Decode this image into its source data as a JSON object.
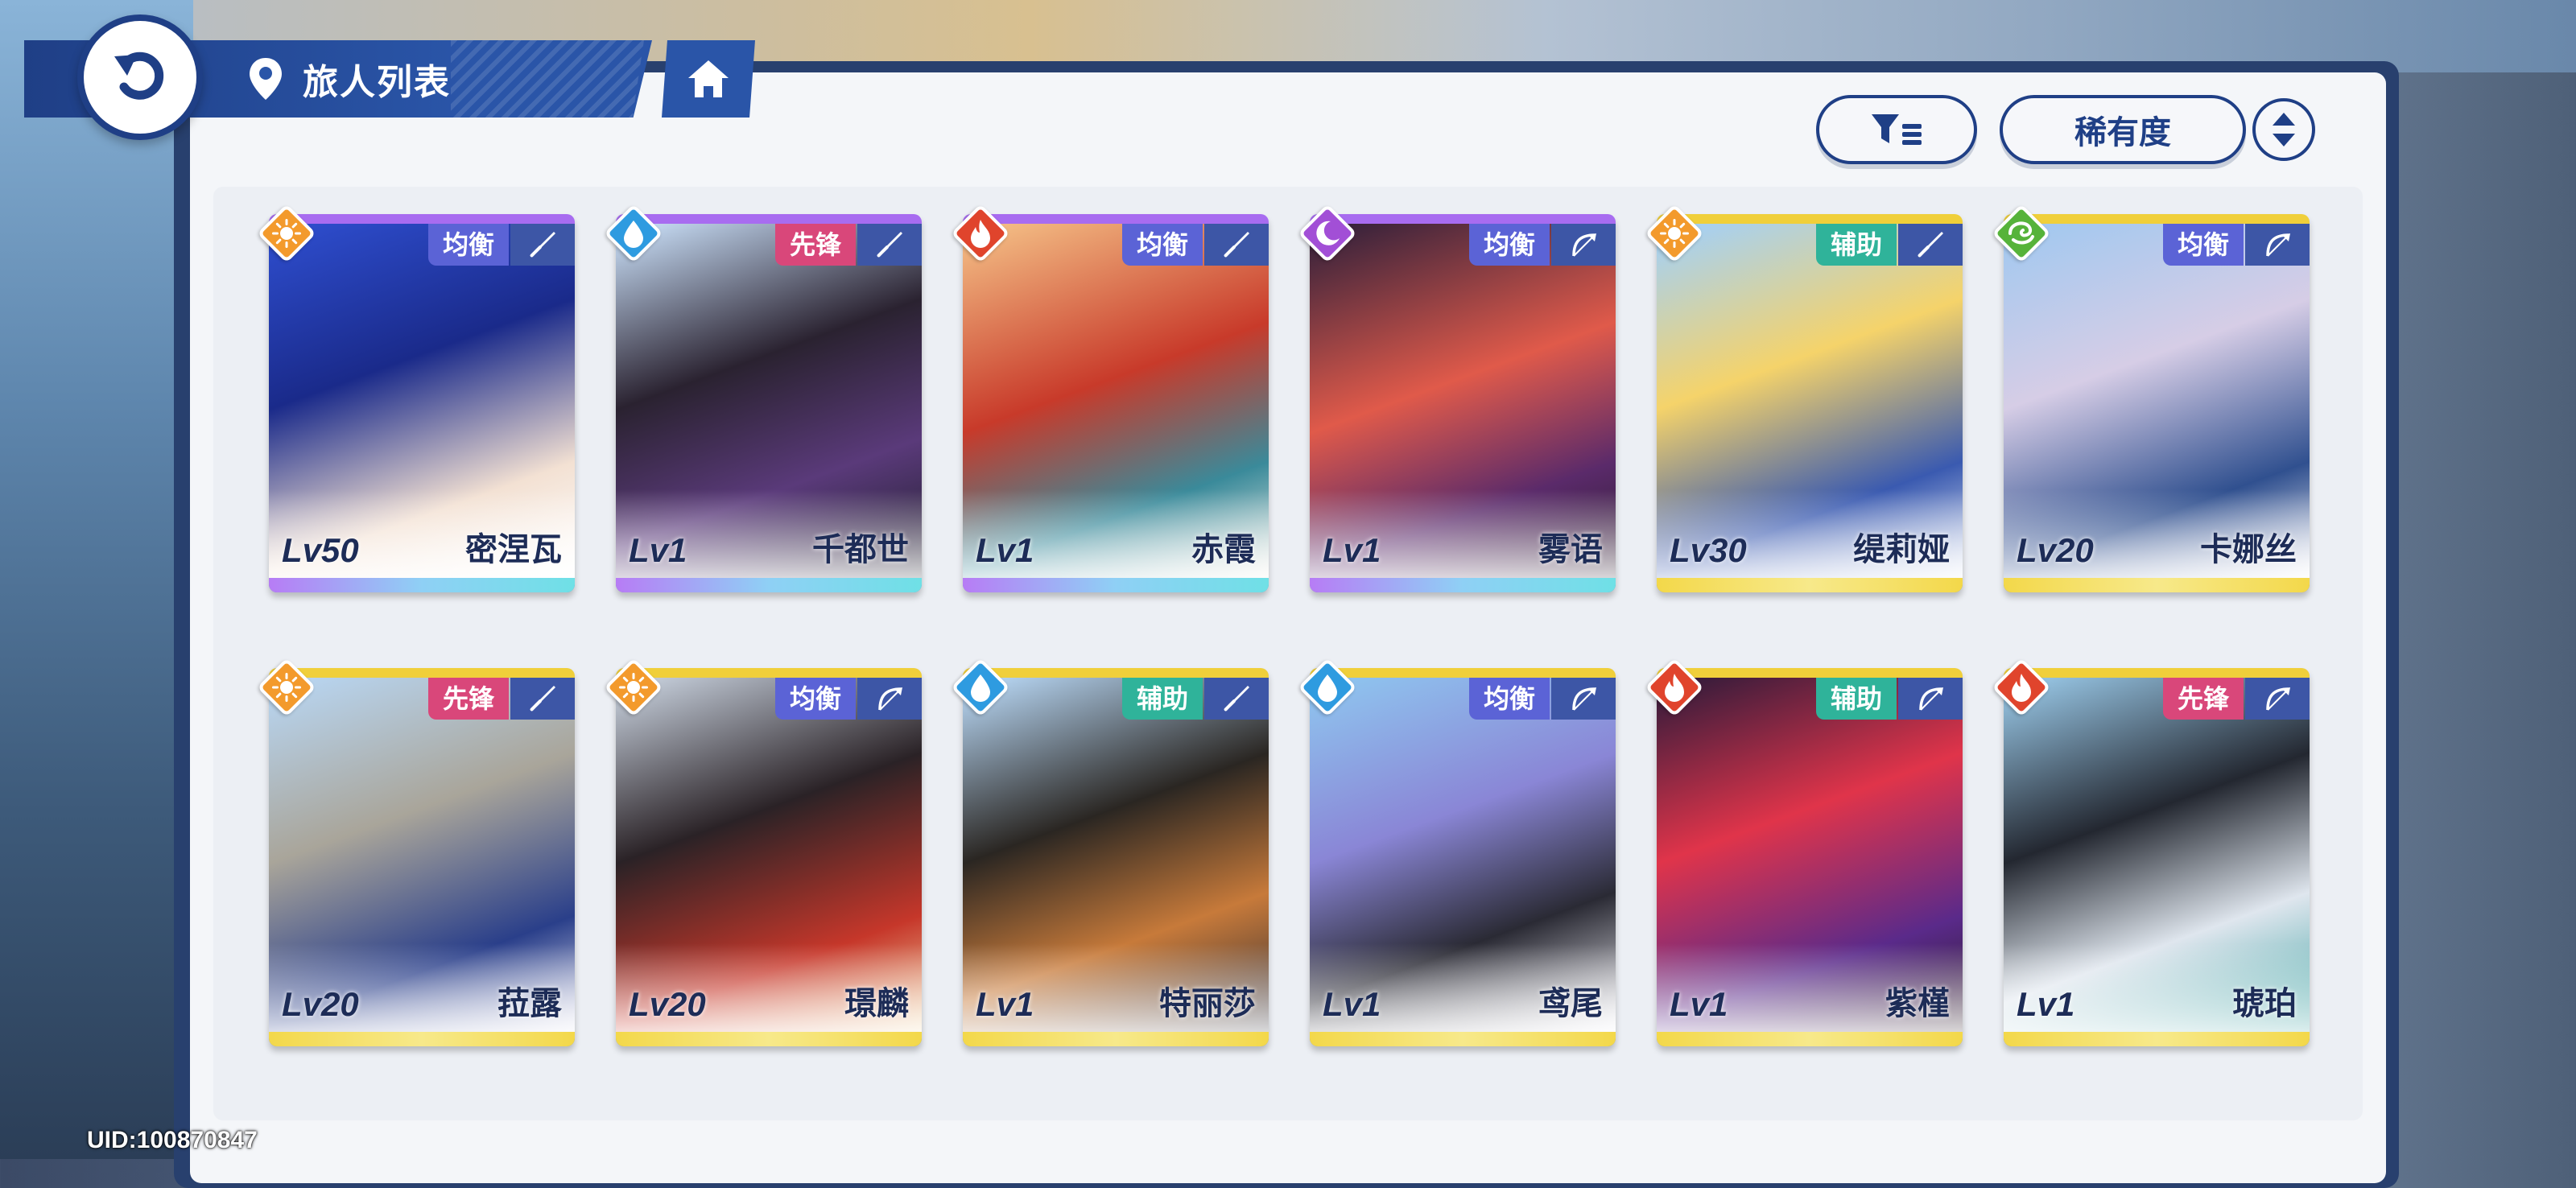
{
  "header": {
    "title": "旅人列表"
  },
  "toolbar": {
    "sort_label": "稀有度"
  },
  "user": {
    "uid": "UID:100870847"
  },
  "colors": {
    "navy": "#1f3f86",
    "role_balance": "#5b63d6",
    "role_vanguard": "#d9477a",
    "role_support": "#2fb39a",
    "rarity_purple": "#a86cf0",
    "rarity_gold": "#f0cf3a"
  },
  "characters": [
    {
      "name": "密涅瓦",
      "level": "Lv50",
      "role": "均衡",
      "element": "sun-icon",
      "weapon": "sword-icon",
      "rarity": "purple"
    },
    {
      "name": "千都世",
      "level": "Lv1",
      "role": "先锋",
      "element": "water-icon",
      "weapon": "sword-icon",
      "rarity": "purple"
    },
    {
      "name": "赤霞",
      "level": "Lv1",
      "role": "均衡",
      "element": "fire-icon",
      "weapon": "sword-icon",
      "rarity": "purple"
    },
    {
      "name": "雾语",
      "level": "Lv1",
      "role": "均衡",
      "element": "moon-icon",
      "weapon": "bow-icon",
      "rarity": "purple"
    },
    {
      "name": "缇莉娅",
      "level": "Lv30",
      "role": "辅助",
      "element": "sun-icon",
      "weapon": "sword-icon",
      "rarity": "gold"
    },
    {
      "name": "卡娜丝",
      "level": "Lv20",
      "role": "均衡",
      "element": "wind-icon",
      "weapon": "bow-icon",
      "rarity": "gold"
    },
    {
      "name": "菈露",
      "level": "Lv20",
      "role": "先锋",
      "element": "sun-icon",
      "weapon": "sword-icon",
      "rarity": "gold"
    },
    {
      "name": "璟麟",
      "level": "Lv20",
      "role": "均衡",
      "element": "sun-icon",
      "weapon": "bow-icon",
      "rarity": "gold"
    },
    {
      "name": "特丽莎",
      "level": "Lv1",
      "role": "辅助",
      "element": "water-icon",
      "weapon": "sword-icon",
      "rarity": "gold"
    },
    {
      "name": "鸢尾",
      "level": "Lv1",
      "role": "均衡",
      "element": "water-icon",
      "weapon": "bow-icon",
      "rarity": "gold"
    },
    {
      "name": "紫槿",
      "level": "Lv1",
      "role": "辅助",
      "element": "fire-icon",
      "weapon": "bow-icon",
      "rarity": "gold"
    },
    {
      "name": "琥珀",
      "level": "Lv1",
      "role": "先锋",
      "element": "fire-icon",
      "weapon": "bow-icon",
      "rarity": "gold"
    }
  ]
}
